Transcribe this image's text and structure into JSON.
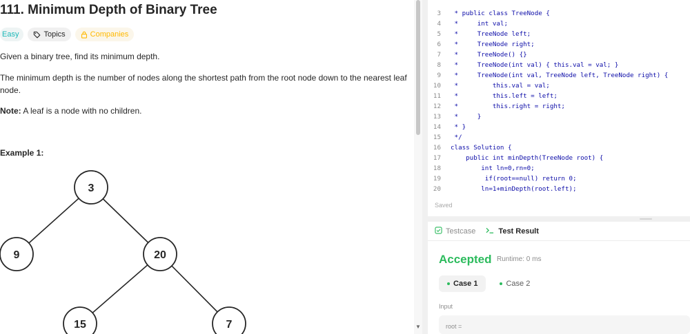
{
  "problem": {
    "title": "111. Minimum Depth of Binary Tree",
    "difficulty": "Easy",
    "topics_label": "Topics",
    "companies_label": "Companies",
    "description_1": "Given a binary tree, find its minimum depth.",
    "description_2": "The minimum depth is the number of nodes along the shortest path from the root node down to the nearest leaf node.",
    "note_label": "Note:",
    "note_text": " A leaf is a node with no children.",
    "example_label": "Example 1:",
    "tree_nodes": [
      "3",
      "9",
      "20",
      "15",
      "7"
    ]
  },
  "editor": {
    "lines": [
      {
        "n": "3",
        "t": " * public class TreeNode {"
      },
      {
        "n": "4",
        "t": " *     int val;"
      },
      {
        "n": "5",
        "t": " *     TreeNode left;"
      },
      {
        "n": "6",
        "t": " *     TreeNode right;"
      },
      {
        "n": "7",
        "t": " *     TreeNode() {}"
      },
      {
        "n": "8",
        "t": " *     TreeNode(int val) { this.val = val; }"
      },
      {
        "n": "9",
        "t": " *     TreeNode(int val, TreeNode left, TreeNode right) {"
      },
      {
        "n": "10",
        "t": " *         this.val = val;"
      },
      {
        "n": "11",
        "t": " *         this.left = left;"
      },
      {
        "n": "12",
        "t": " *         this.right = right;"
      },
      {
        "n": "13",
        "t": " *     }"
      },
      {
        "n": "14",
        "t": " * }"
      },
      {
        "n": "15",
        "t": " */"
      },
      {
        "n": "16",
        "t": "class Solution {"
      },
      {
        "n": "17",
        "t": "    public int minDepth(TreeNode root) {"
      },
      {
        "n": "18",
        "t": "        int ln=0,rn=0;"
      },
      {
        "n": "19",
        "t": "         if(root==null) return 0;"
      },
      {
        "n": "20",
        "t": "        ln=1+minDepth(root.left);"
      }
    ],
    "status": "Saved"
  },
  "results": {
    "tab_testcase": "Testcase",
    "tab_result": "Test Result",
    "verdict": "Accepted",
    "runtime": "Runtime: 0 ms",
    "case_1": "Case 1",
    "case_2": "Case 2",
    "input_label": "Input",
    "input_value": "root ="
  },
  "colors": {
    "accepted": "#2cbb5d",
    "easy": "#1cb8b8",
    "companies": "#ffb800",
    "code_text": "#0c0ca8"
  }
}
